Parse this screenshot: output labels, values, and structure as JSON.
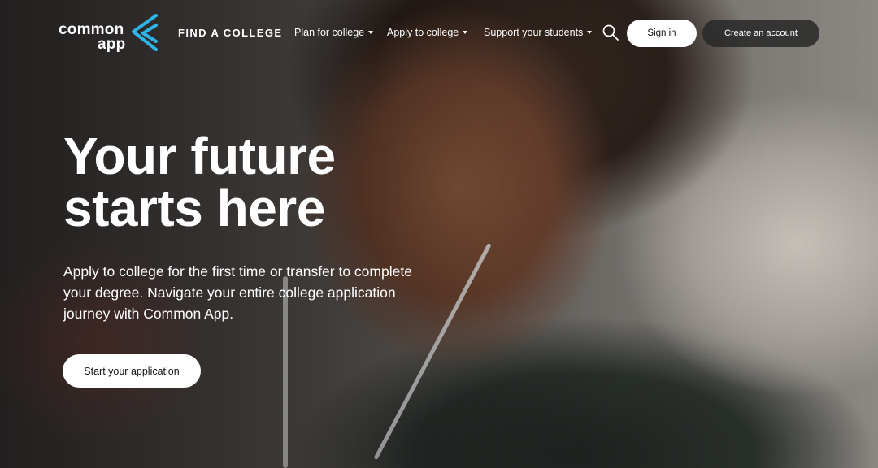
{
  "header": {
    "logo": {
      "line1": "common",
      "line2": "app",
      "mark_color": "#2fb4e9"
    },
    "find_college": "FIND A COLLEGE",
    "nav": [
      {
        "label": "Plan for college"
      },
      {
        "label": "Apply to college"
      },
      {
        "label": "Support your students"
      }
    ],
    "search_icon": "search-icon",
    "sign_in": "Sign in",
    "create_account": "Create an account"
  },
  "hero": {
    "headline_line1": "Your future",
    "headline_line2": "starts here",
    "subtext": "Apply to college for the first time or transfer to complete your degree. Navigate your entire college application journey with Common App.",
    "cta": "Start your application"
  }
}
